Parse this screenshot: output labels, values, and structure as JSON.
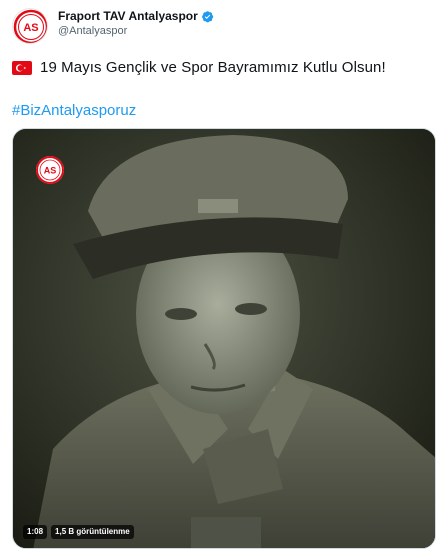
{
  "author": {
    "display_name": "Fraport TAV Antalyaspor",
    "handle": "@Antalyaspor",
    "verified": true,
    "avatar_icon": "antalyaspor-logo-icon",
    "brand_color": "#e30a17"
  },
  "tweet": {
    "flag_icon": "turkey-flag-icon",
    "text": "19 Mayıs Gençlik ve Spor Bayramımız Kutlu Olsun!",
    "hashtag": "#BizAntalyasporuz"
  },
  "media": {
    "type": "video",
    "duration": "1:08",
    "views": "1,5 B görüntülenme",
    "watermark_icon": "antalyaspor-logo-icon"
  },
  "colors": {
    "link": "#1d9bf0",
    "verified": "#1d9bf0",
    "secondary_text": "#536471"
  }
}
